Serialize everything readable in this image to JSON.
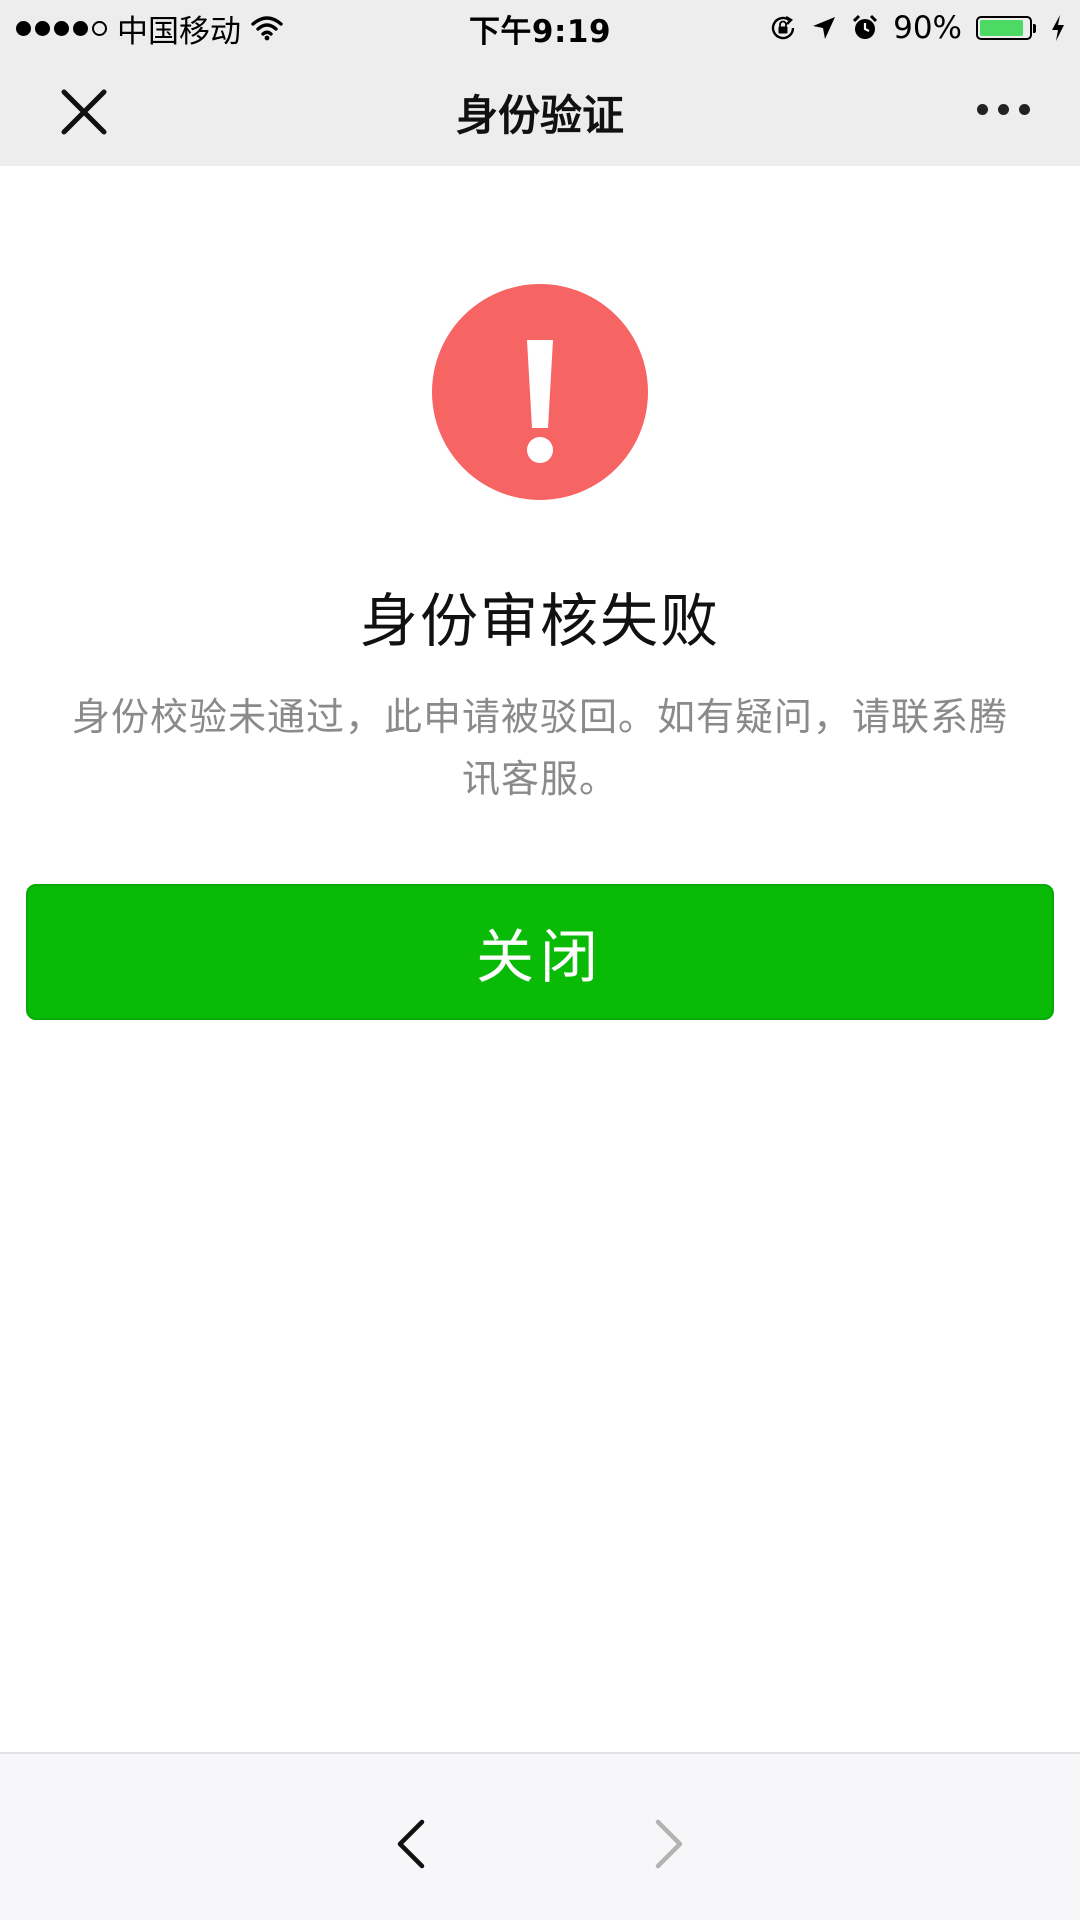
{
  "status_bar": {
    "carrier": "中国移动",
    "time": "下午9:19",
    "battery_percent": "90%",
    "battery_level": 0.9,
    "icons": [
      "wifi-icon",
      "orientation-lock-icon",
      "location-arrow-icon",
      "alarm-icon",
      "battery-icon",
      "charging-bolt-icon"
    ]
  },
  "nav": {
    "title": "身份验证",
    "close_icon": "close-icon",
    "more_icon": "more-dots-icon"
  },
  "result": {
    "icon": "warning-exclamation-icon",
    "title": "身份审核失败",
    "description": "身份校验未通过，此申请被驳回。如有疑问，请联系腾讯客服。",
    "button_label": "关闭"
  },
  "colors": {
    "alert_red": "#f76464",
    "button_green": "#09bb07",
    "desc_gray": "#8a8a8a",
    "topbar_bg": "#ededed"
  },
  "toolbar": {
    "back_icon": "chevron-left-icon",
    "forward_icon": "chevron-right-icon"
  }
}
